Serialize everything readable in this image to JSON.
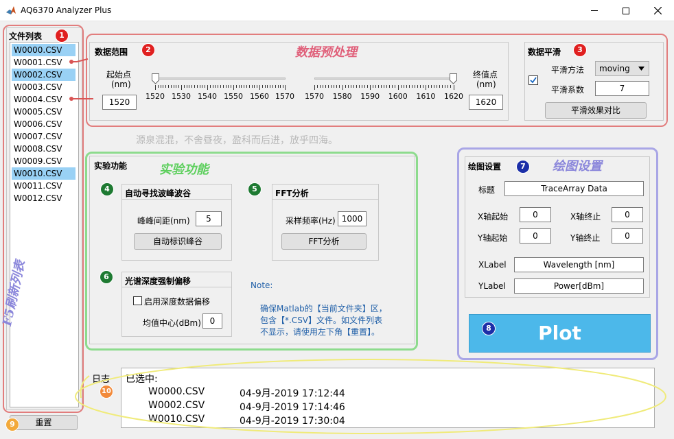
{
  "window": {
    "title": "AQ6370 Analyzer Plus"
  },
  "file_list": {
    "header": "文件列表",
    "items": [
      "W0000.CSV",
      "W0001.CSV",
      "W0002.CSV",
      "W0003.CSV",
      "W0004.CSV",
      "W0005.CSV",
      "W0006.CSV",
      "W0007.CSV",
      "W0008.CSV",
      "W0009.CSV",
      "W0010.CSV",
      "W0011.CSV",
      "W0012.CSV"
    ],
    "selected": [
      "W0000.CSV",
      "W0002.CSV",
      "W0010.CSV"
    ],
    "reset_label": "重置",
    "refresh_annotation": "F5刷新列表"
  },
  "preprocess": {
    "annotation": "数据预处理",
    "range": {
      "title": "数据范围",
      "start_label_1": "起始点",
      "start_label_2": "(nm)",
      "start_value": "1520",
      "end_label_1": "终值点",
      "end_label_2": "(nm)",
      "end_value": "1620",
      "left_ticks": [
        "1520",
        "1530",
        "1540",
        "1550",
        "1560",
        "1570"
      ],
      "right_ticks": [
        "1570",
        "1580",
        "1590",
        "1600",
        "1610",
        "1620"
      ]
    },
    "smooth": {
      "title": "数据平滑",
      "method_label": "平滑方法",
      "method_value": "moving",
      "factor_label": "平滑系数",
      "factor_value": "7",
      "compare_button": "平滑效果对比"
    }
  },
  "motto": "源泉混混，不舍昼夜，盈科而后进，放乎四海。",
  "experiment": {
    "title": "实验功能",
    "annotation": "实验功能",
    "peak": {
      "title": "自动寻找波峰波谷",
      "spacing_label": "峰峰间距(nm)",
      "spacing_value": "5",
      "button": "自动标识峰谷"
    },
    "fft": {
      "title": "FFT分析",
      "rate_label": "采样频率(Hz)",
      "rate_value": "1000",
      "button": "FFT分析"
    },
    "offset": {
      "title": "光谱深度强制偏移",
      "enable_label": "启用深度数据偏移",
      "center_label": "均值中心(dBm)",
      "center_value": "0"
    },
    "note_title": "Note:",
    "note_text_1": "确保Matlab的【当前文件夹】区，",
    "note_text_2": "包含【*.CSV】文件。如文件列表",
    "note_text_3": "不显示，请使用左下角【重置】。"
  },
  "plot_settings": {
    "title": "绘图设置",
    "annotation": "绘图设置",
    "title_label": "标题",
    "title_value": "TraceArray Data",
    "x_start_label": "X轴起始",
    "x_start_value": "0",
    "x_end_label": "X轴终止",
    "x_end_value": "0",
    "y_start_label": "Y轴起始",
    "y_start_value": "0",
    "y_end_label": "Y轴终止",
    "y_end_value": "0",
    "xlabel_label": "XLabel",
    "xlabel_value": "Wavelength [nm]",
    "ylabel_label": "YLabel",
    "ylabel_value": "Power[dBm]",
    "plot_button": "Plot"
  },
  "log": {
    "label": "日志",
    "header": "已选中:",
    "rows": [
      {
        "file": "W0000.CSV",
        "time": "04-9月-2019 17:12:44"
      },
      {
        "file": "W0002.CSV",
        "time": "04-9月-2019 17:14:46"
      },
      {
        "file": "W0010.CSV",
        "time": "04-9月-2019 17:30:04"
      }
    ]
  },
  "badges": [
    "1",
    "2",
    "3",
    "4",
    "5",
    "6",
    "7",
    "8",
    "9",
    "10"
  ],
  "colors": {
    "red_annotation": "#e27d7d",
    "green_annotation": "#8ddb8d",
    "blue_annotation": "#a9a6e6",
    "yellow_annotation": "#f0eb7a",
    "plot_button": "#4cb8ea",
    "selection": "#99d1f5"
  }
}
